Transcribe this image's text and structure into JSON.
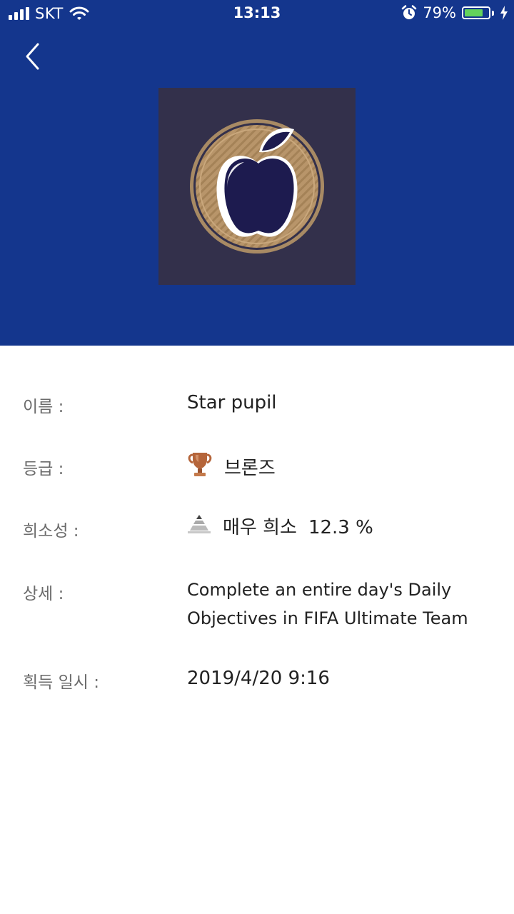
{
  "status_bar": {
    "carrier": "SKT",
    "time": "13:13",
    "battery_percent": "79%",
    "battery_level": 0.79,
    "battery_color": "#63d35b"
  },
  "header": {
    "background": "#14368d",
    "back_icon": "chevron-left-icon",
    "badge_icon": "apple-trophy-badge"
  },
  "details": {
    "name_label": "이름 :",
    "name_value": "Star pupil",
    "grade_label": "등급 :",
    "grade_icon": "bronze-trophy-icon",
    "grade_value": "브론즈",
    "rarity_label": "희소성 :",
    "rarity_icon": "rarity-pyramid-icon",
    "rarity_value": "매우 희소",
    "rarity_percent": "12.3 %",
    "desc_label": "상세 :",
    "desc_line1": "Complete an entire day's Daily",
    "desc_line2": "Objectives in FIFA Ultimate Team",
    "date_label": "획득 일시 :",
    "date_value": "2019/4/20 9:16"
  }
}
